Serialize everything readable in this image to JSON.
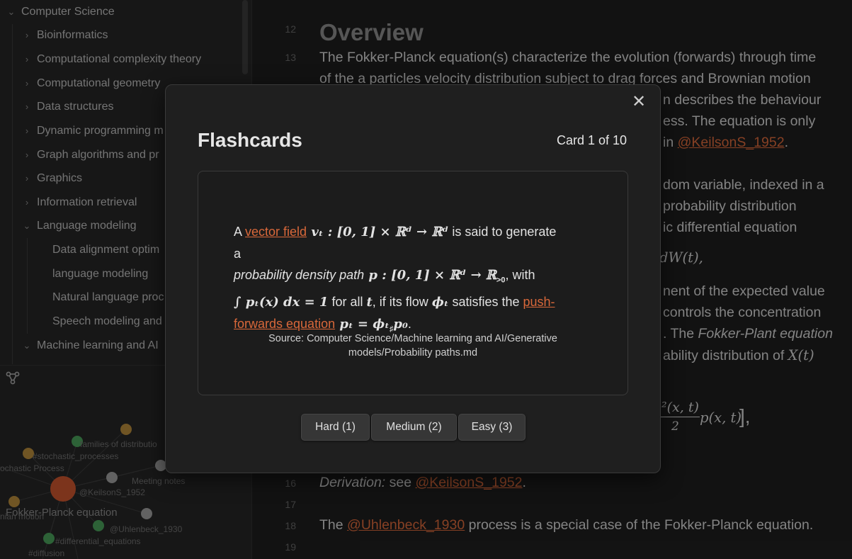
{
  "sidebar": {
    "tree": [
      {
        "label": "Computer Science",
        "expanded": true
      },
      {
        "label": "Bioinformatics",
        "expanded": false
      },
      {
        "label": "Computational complexity theory",
        "expanded": false
      },
      {
        "label": "Computational geometry",
        "expanded": false
      },
      {
        "label": "Data structures",
        "expanded": false
      },
      {
        "label": "Dynamic programming m",
        "expanded": false
      },
      {
        "label": "Graph algorithms and pr",
        "expanded": false
      },
      {
        "label": "Graphics",
        "expanded": false
      },
      {
        "label": "Information retrieval",
        "expanded": false
      },
      {
        "label": "Language modeling",
        "expanded": true
      },
      {
        "label": "Data alignment optim"
      },
      {
        "label": "language modeling"
      },
      {
        "label": "Natural language proc"
      },
      {
        "label": "Speech modeling and"
      },
      {
        "label": "Machine learning and AI",
        "expanded": true
      }
    ],
    "graph_labels": {
      "families": "families of distributio",
      "stochastic_processes": "#stochastic_processes",
      "stochastic_process": "ochastic Process",
      "meeting_notes": "Meeting notes",
      "keilson": "@KeilsonS_1952",
      "fokker_planck": "Fokker-Planck equation",
      "brownian": "nian motion",
      "uhlenbeck": "@Uhlenbeck_1930",
      "differential": "#differential_equations",
      "diffusion": "#diffusion"
    }
  },
  "editor": {
    "line_numbers": {
      "l12": "12",
      "l13": "13",
      "l16": "16",
      "l17": "17",
      "l18": "18",
      "l19": "19"
    },
    "heading": "Overview",
    "p13_line1": "The Fokker-Planck equation(s) characterize the evolution (forwards) through time",
    "p13_line2": "of the a particles velocity distribution subject to drag forces and Brownian motion",
    "frag_describes": "n describes the behaviour",
    "frag_ess": "ess. The equation is only",
    "frag_in": "in ",
    "frag_keilson_link": "@KeilsonS_1952",
    "frag_period": ".",
    "frag_dom": "dom variable, indexed in a",
    "frag_probdist": "probability distribution",
    "frag_ic": "ic differential equation",
    "frag_dw": "dW(t),",
    "frag_ment": "nent of the expected value",
    "frag_controls": "controls the concentration",
    "frag_the": ". The ",
    "frag_fokker_plant": "Fokker-Plant equation",
    "frag_ability": "ability distribution of ",
    "frag_xt": "X(t)",
    "frag_formula_top": "²(x, t)",
    "frag_formula_bottom": "2",
    "frag_formula_right": "p(x, t)",
    "frag_formula_bracket": "],",
    "l16_prefix": "Derivation:",
    "l16_see": " see ",
    "l16_link": "@KeilsonS_1952",
    "l16_end": ".",
    "l18_prefix": "The ",
    "l18_link": "@Uhlenbeck_1930",
    "l18_suffix": " process is a special case of the Fokker-Planck equation."
  },
  "modal": {
    "title": "Flashcards",
    "counter": "Card 1 of 10",
    "close_icon": "close-icon",
    "card": {
      "t1": "A ",
      "link_vector_field": "vector field",
      "m1": " vₜ : [0, 1] × ℝᵈ → ℝᵈ",
      "t2": " is said to generate a",
      "t3_italic": "probability density path",
      "m2": " p : [0, 1] × ℝᵈ → ℝ",
      "m2_sub": ">0",
      "t4": ", with",
      "m3": "∫ pₜ(x) dx = 1",
      "t5": " for all ",
      "m4": "t",
      "t6": ", if its flow ",
      "m5": "ϕₜ",
      "t7": " satisfies the ",
      "link_push": "push-forwards equation",
      "m6": " pₜ = ϕₜ",
      "m6_sub": "♯",
      "m6_end": "p₀",
      "t8": ".",
      "source": "Source: Computer Science/Machine learning and AI/Generative models/Probability paths.md"
    },
    "buttons": {
      "hard": "Hard (1)",
      "medium": "Medium (2)",
      "easy": "Easy (3)"
    },
    "colors": {
      "link": "#d9683a",
      "accent_node": "#c9552e"
    }
  }
}
